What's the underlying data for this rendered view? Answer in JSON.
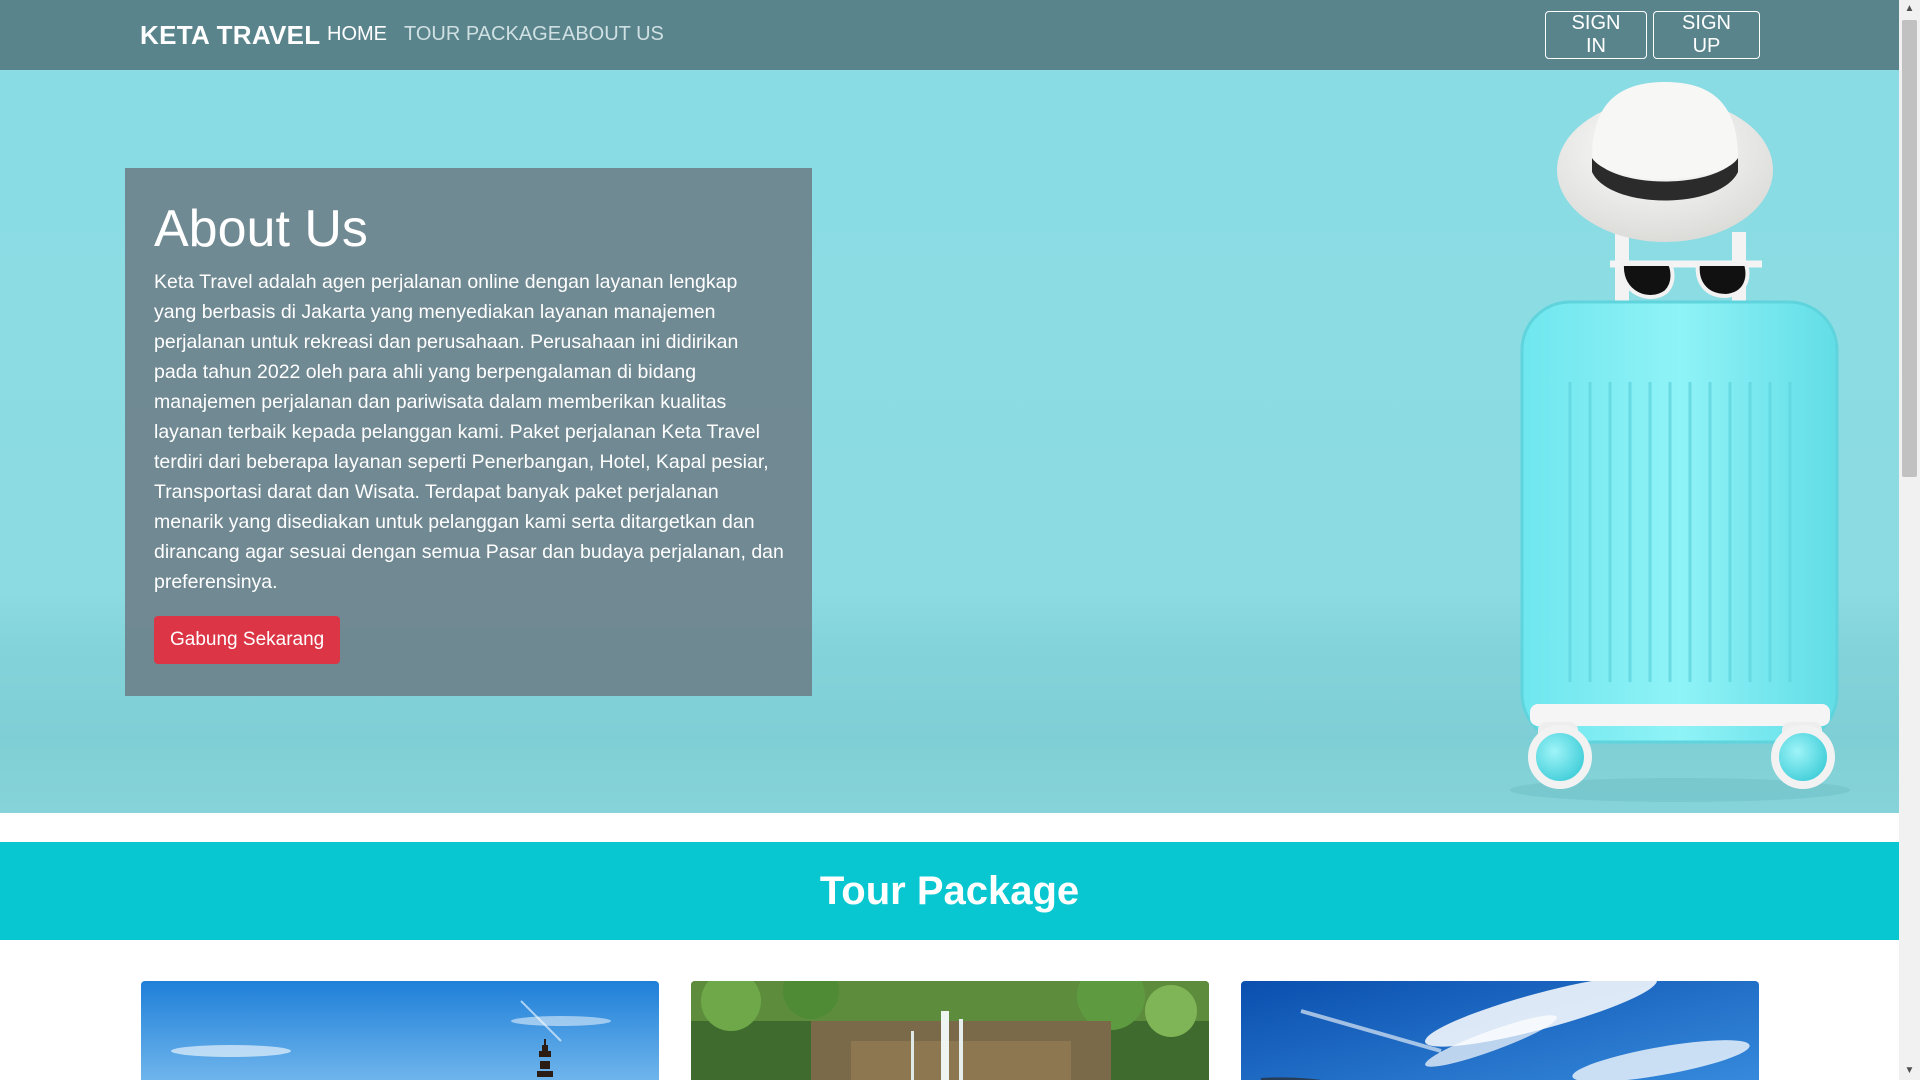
{
  "navbar": {
    "brand": "KETA TRAVEL",
    "links": [
      "HOME",
      "TOUR PACKAGE",
      "ABOUT US"
    ],
    "sign_in": "SIGN IN",
    "sign_up": "SIGN UP"
  },
  "hero": {
    "title": "About Us",
    "text": "Keta Travel adalah agen perjalanan online dengan layanan lengkap yang berbasis di Jakarta yang menyediakan layanan manajemen perjalanan untuk rekreasi dan perusahaan. Perusahaan ini didirikan pada tahun 2022 oleh para ahli yang berpengalaman di bidang manajemen perjalanan dan pariwisata dalam memberikan kualitas layanan terbaik kepada pelanggan kami. Paket perjalanan Keta Travel terdiri dari beberapa layanan seperti Penerbangan, Hotel, Kapal pesiar, Transportasi darat dan Wisata. Terdapat banyak paket perjalanan menarik yang disediakan untuk pelanggan kami serta ditargetkan dan dirancang agar sesuai dengan semua Pasar dan budaya perjalanan, dan preferensinya.",
    "cta": "Gabung Sekarang"
  },
  "tour": {
    "title": "Tour Package"
  },
  "colors": {
    "navbar": "#5a848c",
    "hero": "#8adce4",
    "accent": "#08c7d0",
    "cta": "#dc3545"
  },
  "icons": {
    "scroll_up": "triangle-up-icon",
    "scroll_down": "triangle-down-icon"
  }
}
